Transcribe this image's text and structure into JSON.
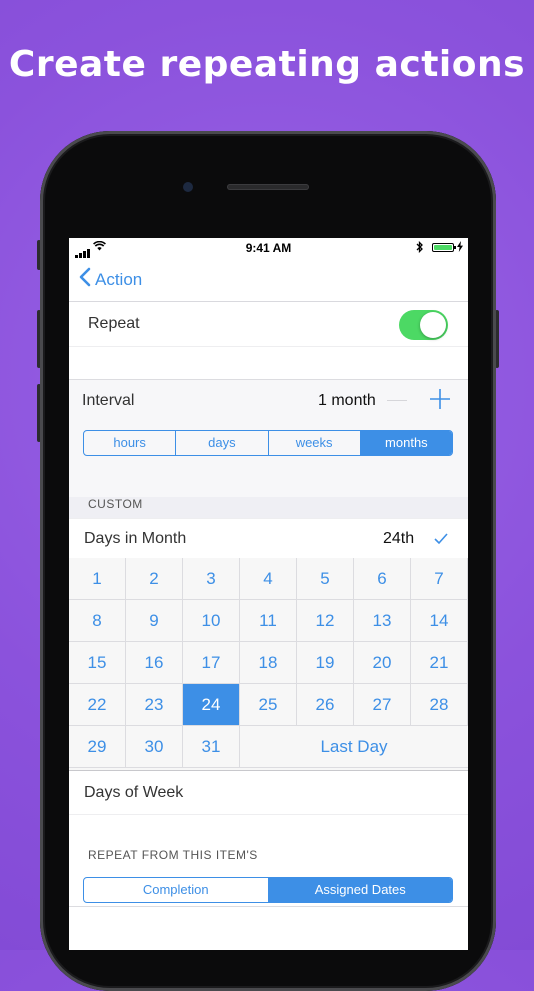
{
  "headline": "Create repeating actions",
  "status": {
    "time": "9:41 AM"
  },
  "nav": {
    "back_label": "Action"
  },
  "repeat": {
    "label": "Repeat",
    "enabled": true
  },
  "interval": {
    "label": "Interval",
    "value": "1 month",
    "minus": "—",
    "plus": "+",
    "units": [
      "hours",
      "days",
      "weeks",
      "months"
    ],
    "selected_unit": "months"
  },
  "custom": {
    "header": "CUSTOM",
    "days_in_month_label": "Days in Month",
    "days_in_month_value": "24th",
    "selected_day": "24",
    "days": [
      "1",
      "2",
      "3",
      "4",
      "5",
      "6",
      "7",
      "8",
      "9",
      "10",
      "11",
      "12",
      "13",
      "14",
      "15",
      "16",
      "17",
      "18",
      "19",
      "20",
      "21",
      "22",
      "23",
      "24",
      "25",
      "26",
      "27",
      "28",
      "29",
      "30",
      "31"
    ],
    "last_day_label": "Last Day",
    "days_of_week_label": "Days of Week"
  },
  "repeat_from": {
    "header": "REPEAT FROM THIS ITEM'S",
    "options": [
      "Completion",
      "Assigned Dates"
    ],
    "selected": "Assigned Dates"
  },
  "colors": {
    "accent": "#3d8fe6",
    "toggle_on": "#4cd964",
    "background": "#8b52dc"
  }
}
